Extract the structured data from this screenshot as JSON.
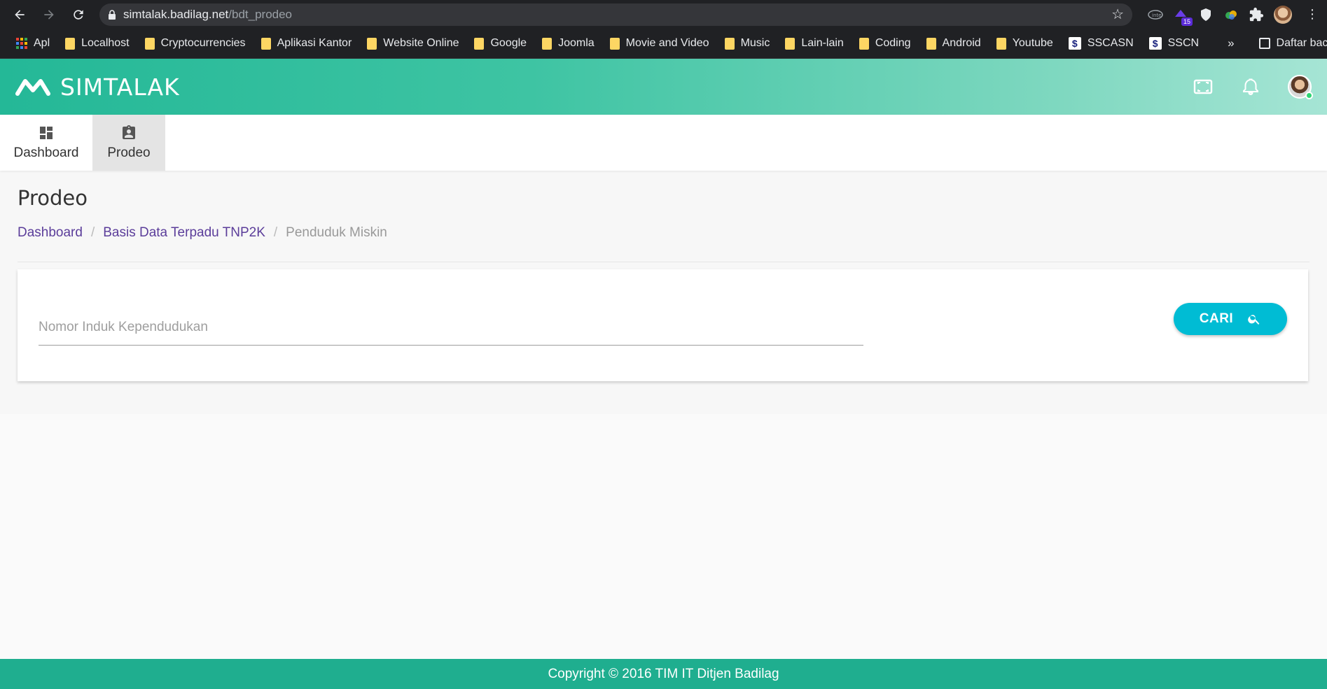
{
  "browser": {
    "url_host": "simtalak.badilag.net",
    "url_path": "/bdt_prodeo",
    "extension_badge": "15",
    "bookmarks": [
      {
        "label": "Apl",
        "icon": "apps-grid-icon"
      },
      {
        "label": "Localhost",
        "icon": "folder-icon"
      },
      {
        "label": "Cryptocurrencies",
        "icon": "folder-icon"
      },
      {
        "label": "Aplikasi Kantor",
        "icon": "folder-icon"
      },
      {
        "label": "Website Online",
        "icon": "folder-icon"
      },
      {
        "label": "Google",
        "icon": "folder-icon"
      },
      {
        "label": "Joomla",
        "icon": "folder-icon"
      },
      {
        "label": "Movie and Video",
        "icon": "folder-icon"
      },
      {
        "label": "Music",
        "icon": "folder-icon"
      },
      {
        "label": "Lain-lain",
        "icon": "folder-icon"
      },
      {
        "label": "Coding",
        "icon": "folder-icon"
      },
      {
        "label": "Android",
        "icon": "folder-icon"
      },
      {
        "label": "Youtube",
        "icon": "folder-icon"
      },
      {
        "label": "SSCASN",
        "icon": "sscasn-icon"
      },
      {
        "label": "SSCN",
        "icon": "sscasn-icon"
      }
    ],
    "bookmarks_more": "»",
    "reading_list": "Daftar bacaan"
  },
  "header": {
    "brand": "SIMTALAK"
  },
  "nav": {
    "tabs": [
      {
        "label": "Dashboard",
        "icon": "dashboard-icon",
        "active": false
      },
      {
        "label": "Prodeo",
        "icon": "assignment-ind-icon",
        "active": true
      }
    ]
  },
  "main": {
    "title": "Prodeo",
    "breadcrumb": [
      {
        "label": "Dashboard"
      },
      {
        "label": "Basis Data Terpadu TNP2K"
      },
      {
        "label": "Penduduk Miskin"
      }
    ],
    "search": {
      "placeholder": "Nomor Induk Kependudukan",
      "value": "",
      "button_label": "CARI"
    }
  },
  "footer": {
    "text": "Copyright © 2016 TIM IT Ditjen Badilag"
  },
  "colors": {
    "header_start": "#24b897",
    "header_end": "#a6e5d5",
    "button": "#00bcd4",
    "footer": "#1fae8f",
    "breadcrumb_link": "#5b3d9a"
  }
}
